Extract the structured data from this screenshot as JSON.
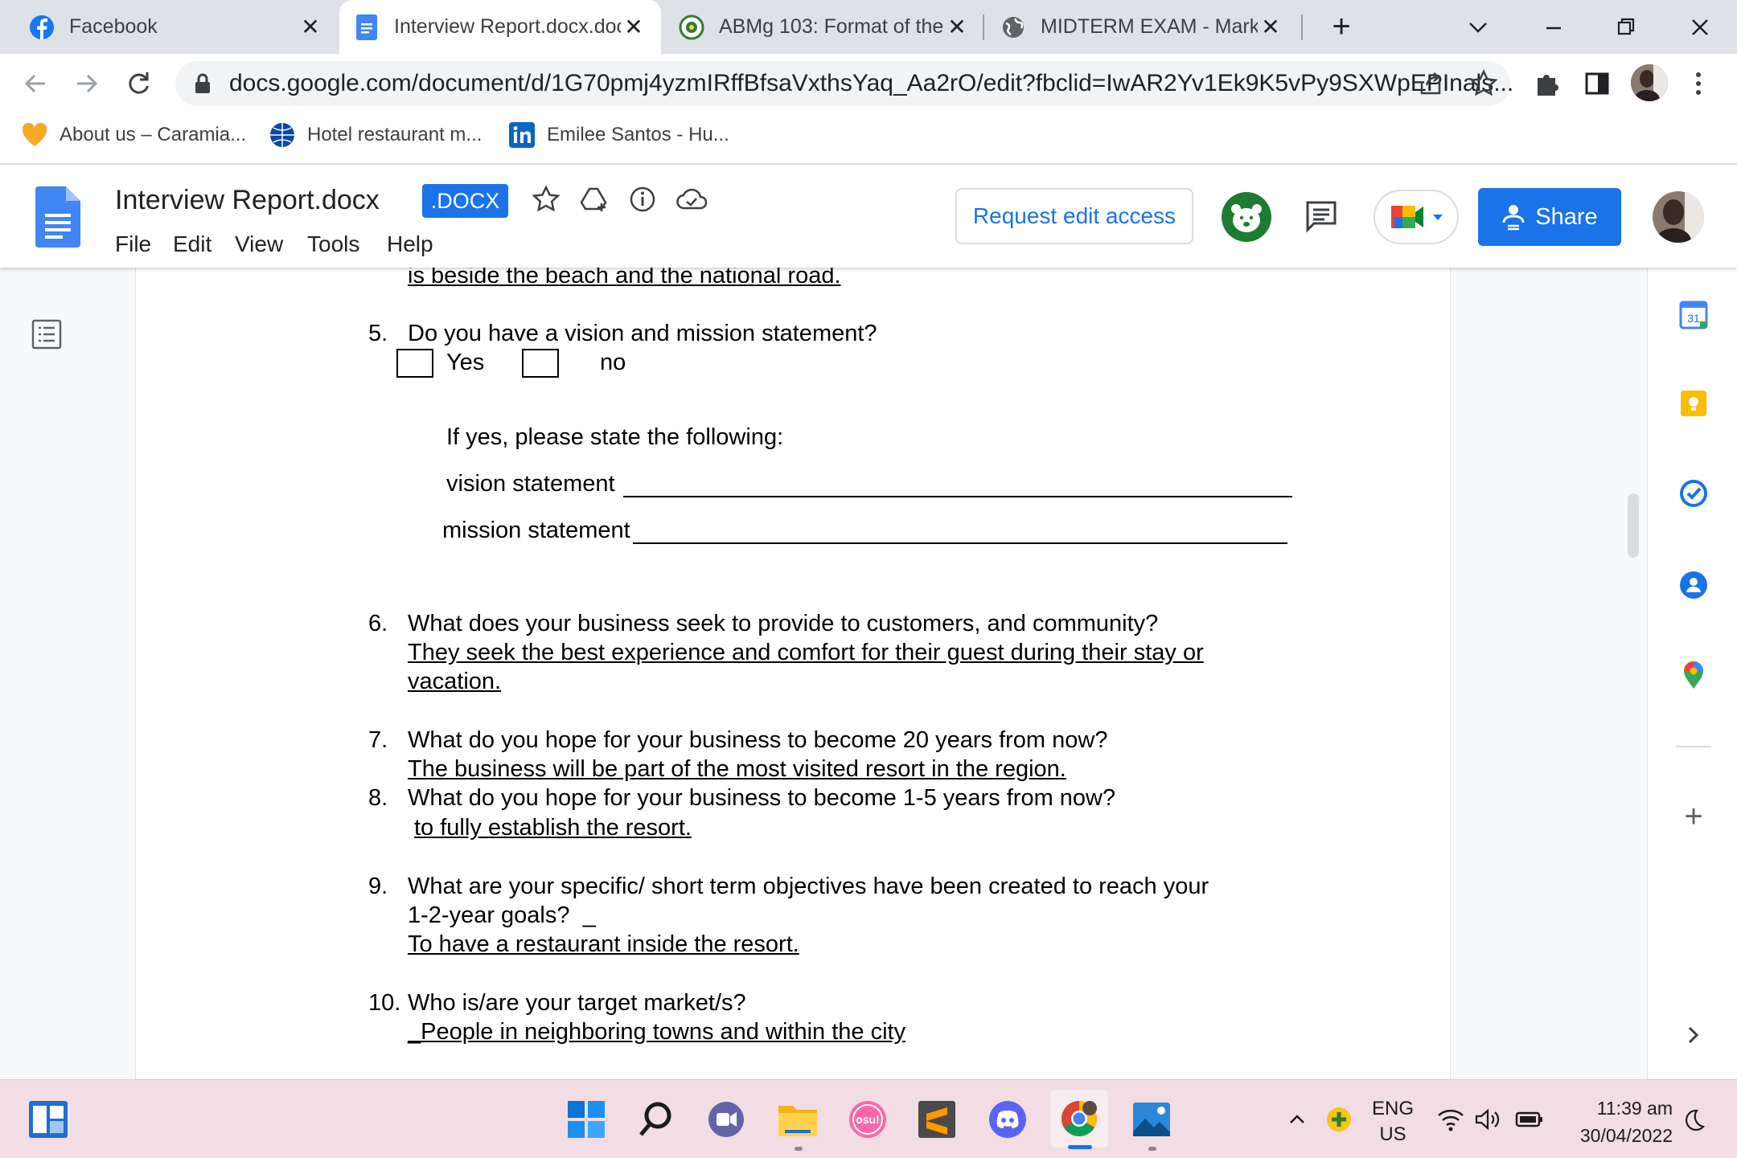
{
  "tabs": [
    {
      "title": "Facebook",
      "icon": "facebook-icon"
    },
    {
      "title": "Interview Report.docx.doc",
      "icon": "google-docs-icon",
      "active": true
    },
    {
      "title": "ABMg 103: Format of the",
      "icon": "school-seal-icon"
    },
    {
      "title": "MIDTERM EXAM - Market",
      "icon": "globe-icon"
    }
  ],
  "address_bar": {
    "url": "docs.google.com/document/d/1G70pmj4yzmIRffBfsaVxthsYaq_Aa2rO/edit?fbclid=IwAR2Yv1Ek9K5vPy9SXWpEPInals..."
  },
  "bookmarks": [
    {
      "label": "About us – Caramia...",
      "icon": "heart-icon"
    },
    {
      "label": "Hotel restaurant m...",
      "icon": "globe-icon"
    },
    {
      "label": "Emilee Santos - Hu...",
      "icon": "linkedin-icon"
    }
  ],
  "docs": {
    "title": "Interview Report.docx",
    "badge": ".DOCX",
    "menu": [
      "File",
      "Edit",
      "View",
      "Tools",
      "Help"
    ],
    "request_edit": "Request edit access",
    "share": "Share"
  },
  "document": {
    "top_fragment": "is beside the beach and the national road.",
    "q5": {
      "num": "5.",
      "text": "Do you have a vision and mission statement?",
      "yes": "Yes",
      "no": "no"
    },
    "if_yes": "If yes, please state the following:",
    "vision_label": "vision statement",
    "mission_label": "mission statement",
    "q6": {
      "num": "6.",
      "text": "What does your business seek to provide to customers, and community?",
      "answer_1": "They seek the best experience and comfort for their guest during their stay or",
      "answer_2": "vacation."
    },
    "q7": {
      "num": "7.",
      "text": "What do you hope for your business to become 20 years from now?",
      "answer": "The business will be part of the most visited resort in the region."
    },
    "q8": {
      "num": "8.",
      "text": "What do you hope for your business to become 1-5 years from now?",
      "answer": "to fully establish the resort."
    },
    "q9": {
      "num": "9.",
      "text_1": "What are your specific/ short term objectives have been created to reach your",
      "text_2": "1-2-year goals?  _",
      "answer": "To have a restaurant inside the resort."
    },
    "q10": {
      "num": "10.",
      "text": "Who is/are your target market/s?",
      "answer": "_People in neighboring towns and within the city"
    }
  },
  "side_panel": {
    "calendar_day": "31"
  },
  "taskbar": {
    "language": "ENG",
    "region": "US",
    "time": "11:39 am",
    "date": "30/04/2022",
    "osu_label": "osu!"
  },
  "colors": {
    "accent": "#1a73e8",
    "tabstrip": "#dee1e6",
    "taskbar": "#f2dde4"
  }
}
